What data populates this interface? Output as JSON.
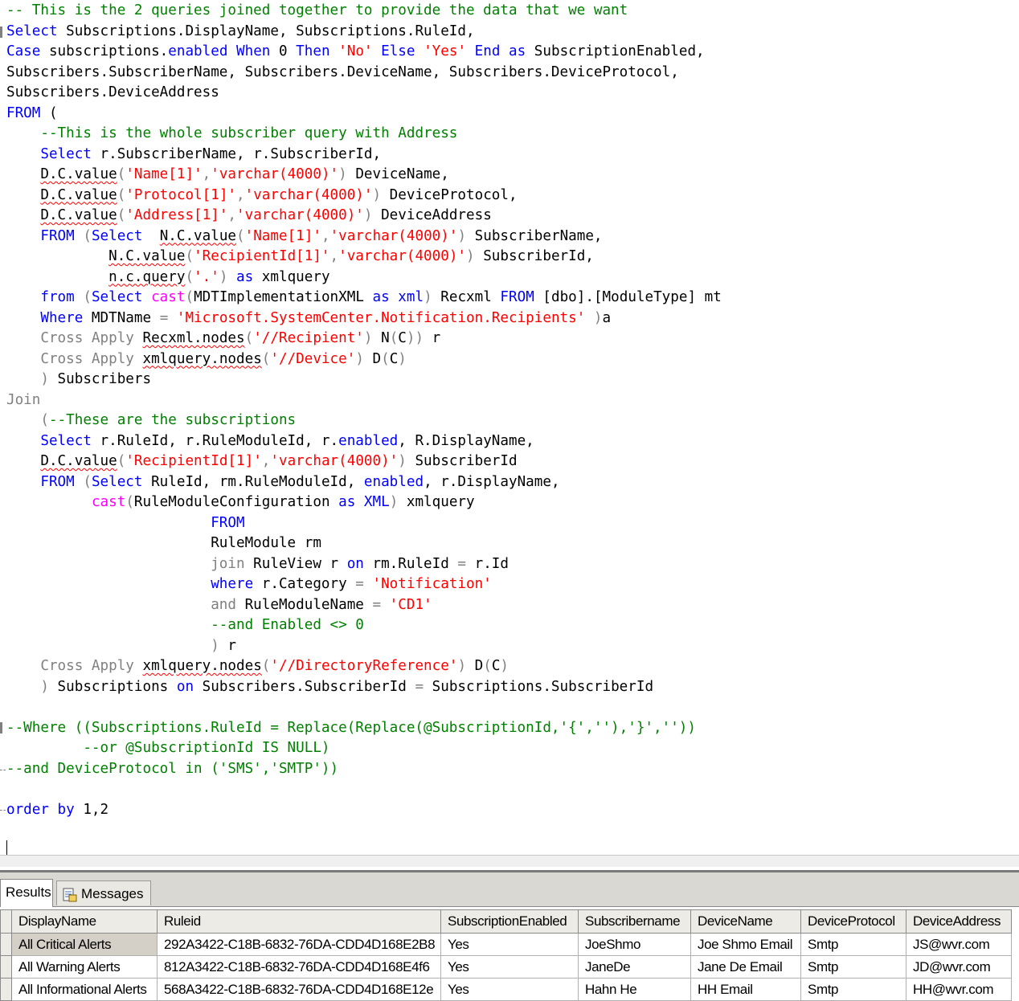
{
  "editor": {
    "lines": [
      [
        {
          "t": "-- This is the 2 queries joined together to provide the data that we want",
          "c": "c"
        }
      ],
      [
        {
          "t": "Select",
          "c": "k"
        },
        {
          "t": " Subscriptions.DisplayName, Subscriptions.RuleId,"
        }
      ],
      [
        {
          "t": "Case",
          "c": "k"
        },
        {
          "t": " subscriptions."
        },
        {
          "t": "enabled",
          "c": "k"
        },
        {
          "t": " "
        },
        {
          "t": "When",
          "c": "k"
        },
        {
          "t": " 0 "
        },
        {
          "t": "Then",
          "c": "k"
        },
        {
          "t": " "
        },
        {
          "t": "'No'",
          "c": "s"
        },
        {
          "t": " "
        },
        {
          "t": "Else",
          "c": "k"
        },
        {
          "t": " "
        },
        {
          "t": "'Yes'",
          "c": "s"
        },
        {
          "t": " "
        },
        {
          "t": "End",
          "c": "k"
        },
        {
          "t": " "
        },
        {
          "t": "as",
          "c": "k"
        },
        {
          "t": " SubscriptionEnabled,"
        }
      ],
      [
        {
          "t": "Subscribers.SubscriberName, Subscribers.DeviceName, Subscribers.DeviceProtocol,"
        }
      ],
      [
        {
          "t": "Subscribers.DeviceAddress"
        }
      ],
      [
        {
          "t": "FROM",
          "c": "k"
        },
        {
          "t": " ("
        }
      ],
      [
        {
          "t": "    "
        },
        {
          "t": "--This is the whole subscriber query with Address",
          "c": "c"
        }
      ],
      [
        {
          "t": "    "
        },
        {
          "t": "Select",
          "c": "k"
        },
        {
          "t": " r.SubscriberName, r.SubscriberId,"
        }
      ],
      [
        {
          "t": "    "
        },
        {
          "t": "D.C.value",
          "u": true
        },
        {
          "t": "(",
          "c": "g"
        },
        {
          "t": "'Name[1]'",
          "c": "s"
        },
        {
          "t": ",",
          "c": "g"
        },
        {
          "t": "'varchar(4000)'",
          "c": "s"
        },
        {
          "t": ")",
          "c": "g"
        },
        {
          "t": " DeviceName,"
        }
      ],
      [
        {
          "t": "    "
        },
        {
          "t": "D.C.value",
          "u": true
        },
        {
          "t": "(",
          "c": "g"
        },
        {
          "t": "'Protocol[1]'",
          "c": "s"
        },
        {
          "t": ",",
          "c": "g"
        },
        {
          "t": "'varchar(4000)'",
          "c": "s"
        },
        {
          "t": ")",
          "c": "g"
        },
        {
          "t": " DeviceProtocol,"
        }
      ],
      [
        {
          "t": "    "
        },
        {
          "t": "D.C.value",
          "u": true
        },
        {
          "t": "(",
          "c": "g"
        },
        {
          "t": "'Address[1]'",
          "c": "s"
        },
        {
          "t": ",",
          "c": "g"
        },
        {
          "t": "'varchar(4000)'",
          "c": "s"
        },
        {
          "t": ")",
          "c": "g"
        },
        {
          "t": " DeviceAddress"
        }
      ],
      [
        {
          "t": "    "
        },
        {
          "t": "FROM",
          "c": "k"
        },
        {
          "t": " (",
          "c": "g"
        },
        {
          "t": "Select",
          "c": "k"
        },
        {
          "t": "  "
        },
        {
          "t": "N.C.value",
          "u": true
        },
        {
          "t": "(",
          "c": "g"
        },
        {
          "t": "'Name[1]'",
          "c": "s"
        },
        {
          "t": ",",
          "c": "g"
        },
        {
          "t": "'varchar(4000)'",
          "c": "s"
        },
        {
          "t": ")",
          "c": "g"
        },
        {
          "t": " SubscriberName,"
        }
      ],
      [
        {
          "t": "            "
        },
        {
          "t": "N.C.value",
          "u": true
        },
        {
          "t": "(",
          "c": "g"
        },
        {
          "t": "'RecipientId[1]'",
          "c": "s"
        },
        {
          "t": ",",
          "c": "g"
        },
        {
          "t": "'varchar(4000)'",
          "c": "s"
        },
        {
          "t": ")",
          "c": "g"
        },
        {
          "t": " SubscriberId,"
        }
      ],
      [
        {
          "t": "            "
        },
        {
          "t": "n.c.query",
          "u": true
        },
        {
          "t": "(",
          "c": "g"
        },
        {
          "t": "'.'",
          "c": "s"
        },
        {
          "t": ")",
          "c": "g"
        },
        {
          "t": " "
        },
        {
          "t": "as",
          "c": "k"
        },
        {
          "t": " xmlquery"
        }
      ],
      [
        {
          "t": "    "
        },
        {
          "t": "from",
          "c": "k"
        },
        {
          "t": " (",
          "c": "g"
        },
        {
          "t": "Select",
          "c": "k"
        },
        {
          "t": " "
        },
        {
          "t": "cast",
          "c": "f"
        },
        {
          "t": "(",
          "c": "g"
        },
        {
          "t": "MDTImplementationXML "
        },
        {
          "t": "as",
          "c": "k"
        },
        {
          "t": " "
        },
        {
          "t": "xml",
          "c": "k"
        },
        {
          "t": ")",
          "c": "g"
        },
        {
          "t": " Recxml "
        },
        {
          "t": "FROM",
          "c": "k"
        },
        {
          "t": " [dbo].[ModuleType] mt"
        }
      ],
      [
        {
          "t": "    "
        },
        {
          "t": "Where",
          "c": "k"
        },
        {
          "t": " MDTName "
        },
        {
          "t": "=",
          "c": "g"
        },
        {
          "t": " "
        },
        {
          "t": "'Microsoft.SystemCenter.Notification.Recipients'",
          "c": "s"
        },
        {
          "t": " )",
          "c": "g"
        },
        {
          "t": "a"
        }
      ],
      [
        {
          "t": "    "
        },
        {
          "t": "Cross Apply",
          "c": "g"
        },
        {
          "t": " "
        },
        {
          "t": "Recxml.nodes",
          "u": true
        },
        {
          "t": "(",
          "c": "g"
        },
        {
          "t": "'//Recipient'",
          "c": "s"
        },
        {
          "t": ")",
          "c": "g"
        },
        {
          "t": " N"
        },
        {
          "t": "(",
          "c": "g"
        },
        {
          "t": "C"
        },
        {
          "t": "))",
          "c": "g"
        },
        {
          "t": " r"
        }
      ],
      [
        {
          "t": "    "
        },
        {
          "t": "Cross Apply",
          "c": "g"
        },
        {
          "t": " "
        },
        {
          "t": "xmlquery.nodes",
          "u": true
        },
        {
          "t": "(",
          "c": "g"
        },
        {
          "t": "'//Device'",
          "c": "s"
        },
        {
          "t": ")",
          "c": "g"
        },
        {
          "t": " D"
        },
        {
          "t": "(",
          "c": "g"
        },
        {
          "t": "C"
        },
        {
          "t": ")",
          "c": "g"
        }
      ],
      [
        {
          "t": "    "
        },
        {
          "t": ")",
          "c": "g"
        },
        {
          "t": " Subscribers"
        }
      ],
      [
        {
          "t": "Join",
          "c": "g"
        }
      ],
      [
        {
          "t": "    "
        },
        {
          "t": "(",
          "c": "g"
        },
        {
          "t": "--These are the subscriptions",
          "c": "c"
        }
      ],
      [
        {
          "t": "    "
        },
        {
          "t": "Select",
          "c": "k"
        },
        {
          "t": " r.RuleId, r.RuleModuleId, r."
        },
        {
          "t": "enabled",
          "c": "k"
        },
        {
          "t": ", R.DisplayName,"
        }
      ],
      [
        {
          "t": "    "
        },
        {
          "t": "D.C.value",
          "u": true
        },
        {
          "t": "(",
          "c": "g"
        },
        {
          "t": "'RecipientId[1]'",
          "c": "s"
        },
        {
          "t": ",",
          "c": "g"
        },
        {
          "t": "'varchar(4000)'",
          "c": "s"
        },
        {
          "t": ")",
          "c": "g"
        },
        {
          "t": " SubscriberId"
        }
      ],
      [
        {
          "t": "    "
        },
        {
          "t": "FROM",
          "c": "k"
        },
        {
          "t": " (",
          "c": "g"
        },
        {
          "t": "Select",
          "c": "k"
        },
        {
          "t": " RuleId, rm.RuleModuleId, "
        },
        {
          "t": "enabled",
          "c": "k"
        },
        {
          "t": ", r.DisplayName,"
        }
      ],
      [
        {
          "t": "          "
        },
        {
          "t": "cast",
          "c": "f"
        },
        {
          "t": "(",
          "c": "g"
        },
        {
          "t": "RuleModuleConfiguration "
        },
        {
          "t": "as",
          "c": "k"
        },
        {
          "t": " "
        },
        {
          "t": "XML",
          "c": "k"
        },
        {
          "t": ")",
          "c": "g"
        },
        {
          "t": " xmlquery"
        }
      ],
      [
        {
          "t": "                        "
        },
        {
          "t": "FROM",
          "c": "k"
        }
      ],
      [
        {
          "t": "                        "
        },
        {
          "t": "RuleModule rm"
        }
      ],
      [
        {
          "t": "                        "
        },
        {
          "t": "join",
          "c": "g"
        },
        {
          "t": " RuleView r "
        },
        {
          "t": "on",
          "c": "k"
        },
        {
          "t": " rm.RuleId "
        },
        {
          "t": "=",
          "c": "g"
        },
        {
          "t": " r.Id"
        }
      ],
      [
        {
          "t": "                        "
        },
        {
          "t": "where",
          "c": "k"
        },
        {
          "t": " r.Category "
        },
        {
          "t": "=",
          "c": "g"
        },
        {
          "t": " "
        },
        {
          "t": "'Notification'",
          "c": "s"
        }
      ],
      [
        {
          "t": "                        "
        },
        {
          "t": "and",
          "c": "g"
        },
        {
          "t": " RuleModuleName "
        },
        {
          "t": "=",
          "c": "g"
        },
        {
          "t": " "
        },
        {
          "t": "'CD1'",
          "c": "s"
        }
      ],
      [
        {
          "t": "                        "
        },
        {
          "t": "--and Enabled <> 0",
          "c": "c"
        }
      ],
      [
        {
          "t": "                        "
        },
        {
          "t": ")",
          "c": "g"
        },
        {
          "t": " r"
        }
      ],
      [
        {
          "t": "    "
        },
        {
          "t": "Cross Apply",
          "c": "g"
        },
        {
          "t": " "
        },
        {
          "t": "xmlquery.nodes",
          "u": true
        },
        {
          "t": "(",
          "c": "g"
        },
        {
          "t": "'//DirectoryReference'",
          "c": "s"
        },
        {
          "t": ")",
          "c": "g"
        },
        {
          "t": " D"
        },
        {
          "t": "(",
          "c": "g"
        },
        {
          "t": "C"
        },
        {
          "t": ")",
          "c": "g"
        }
      ],
      [
        {
          "t": "    "
        },
        {
          "t": ")",
          "c": "g"
        },
        {
          "t": " Subscriptions "
        },
        {
          "t": "on",
          "c": "k"
        },
        {
          "t": " Subscribers.SubscriberId "
        },
        {
          "t": "=",
          "c": "g"
        },
        {
          "t": " Subscriptions.SubscriberId"
        }
      ],
      [],
      [
        {
          "t": "--Where ((Subscriptions.RuleId = Replace(Replace(@SubscriptionId,'{',''),'}',''))",
          "c": "c"
        }
      ],
      [
        {
          "t": "         --or @SubscriptionId IS NULL)",
          "c": "c"
        }
      ],
      [
        {
          "t": "--and DeviceProtocol in ('SMS','SMTP'))",
          "c": "c"
        }
      ],
      [],
      [
        {
          "t": "order by",
          "c": "k"
        },
        {
          "t": " 1,2"
        }
      ]
    ]
  },
  "results": {
    "tabs": [
      {
        "label": "Results",
        "active": true
      },
      {
        "label": "Messages",
        "active": false
      }
    ],
    "columns": [
      "DisplayName",
      "Ruleid",
      "SubscriptionEnabled",
      "Subscribername",
      "DeviceName",
      "DeviceProtocol",
      "DeviceAddress"
    ],
    "rows": [
      [
        "All Critical Alerts",
        "292A3422-C18B-6832-76DA-CDD4D168E2B8",
        "Yes",
        "JoeShmo",
        "Joe Shmo Email",
        "Smtp",
        "JS@wvr.com"
      ],
      [
        "All Warning Alerts",
        "812A3422-C18B-6832-76DA-CDD4D168E4f6",
        "Yes",
        "JaneDe",
        "Jane De Email",
        "Smtp",
        "JD@wvr.com"
      ],
      [
        "All Informational Alerts",
        "568A3422-C18B-6832-76DA-CDD4D168E12e",
        "Yes",
        "Hahn He",
        "HH Email",
        "Smtp",
        "HH@wvr.com"
      ]
    ]
  }
}
